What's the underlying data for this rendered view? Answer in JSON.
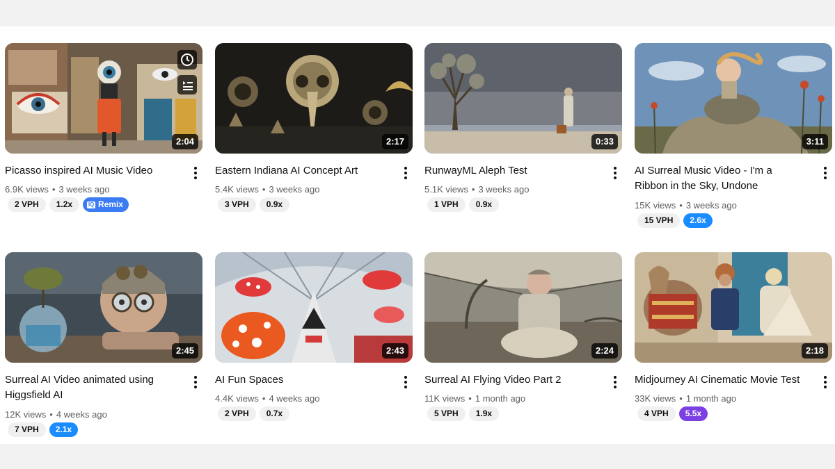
{
  "videos": [
    {
      "title_line1": "Picasso inspired AI Music Video",
      "title_line2": "",
      "duration": "2:04",
      "views": "6.9K views",
      "age": "3 weeks ago",
      "vph": "2 VPH",
      "ratio": "1.2x",
      "ratio_color": "",
      "remix_label": "Remix"
    },
    {
      "title_line1": "Eastern Indiana AI Concept Art",
      "title_line2": "",
      "duration": "2:17",
      "views": "5.4K views",
      "age": "3 weeks ago",
      "vph": "3 VPH",
      "ratio": "0.9x",
      "ratio_color": ""
    },
    {
      "title_line1": "RunwayML Aleph Test",
      "title_line2": "",
      "duration": "0:33",
      "views": "5.1K views",
      "age": "3 weeks ago",
      "vph": "1 VPH",
      "ratio": "0.9x",
      "ratio_color": ""
    },
    {
      "title_line1": "AI Surreal Music Video - I'm a",
      "title_line2": "Ribbon in the Sky, Undone",
      "duration": "3:11",
      "views": "15K views",
      "age": "3 weeks ago",
      "vph": "15 VPH",
      "ratio": "2.6x",
      "ratio_color": "#1a8cff"
    },
    {
      "title_line1": "Surreal AI Video animated using",
      "title_line2": "Higgsfield AI",
      "duration": "2:45",
      "views": "12K views",
      "age": "4 weeks ago",
      "vph": "7 VPH",
      "ratio": "2.1x",
      "ratio_color": "#1a8cff"
    },
    {
      "title_line1": "AI Fun Spaces",
      "title_line2": "",
      "duration": "2:43",
      "views": "4.4K views",
      "age": "4 weeks ago",
      "vph": "2 VPH",
      "ratio": "0.7x",
      "ratio_color": ""
    },
    {
      "title_line1": "Surreal AI Flying Video Part 2",
      "title_line2": "",
      "duration": "2:24",
      "views": "11K views",
      "age": "1 month ago",
      "vph": "5 VPH",
      "ratio": "1.9x",
      "ratio_color": ""
    },
    {
      "title_line1": "Midjourney AI Cinematic Movie Test",
      "title_line2": "",
      "duration": "2:18",
      "views": "33K views",
      "age": "1 month ago",
      "vph": "4 VPH",
      "ratio": "5.5x",
      "ratio_color": "#7b3fe4"
    }
  ],
  "icons": {
    "watch_later": "clock-icon",
    "add_to_queue": "add-to-queue-icon",
    "menu": "more-vertical-icon",
    "remix": "remix-logo-icon"
  },
  "meta_separator": "•"
}
